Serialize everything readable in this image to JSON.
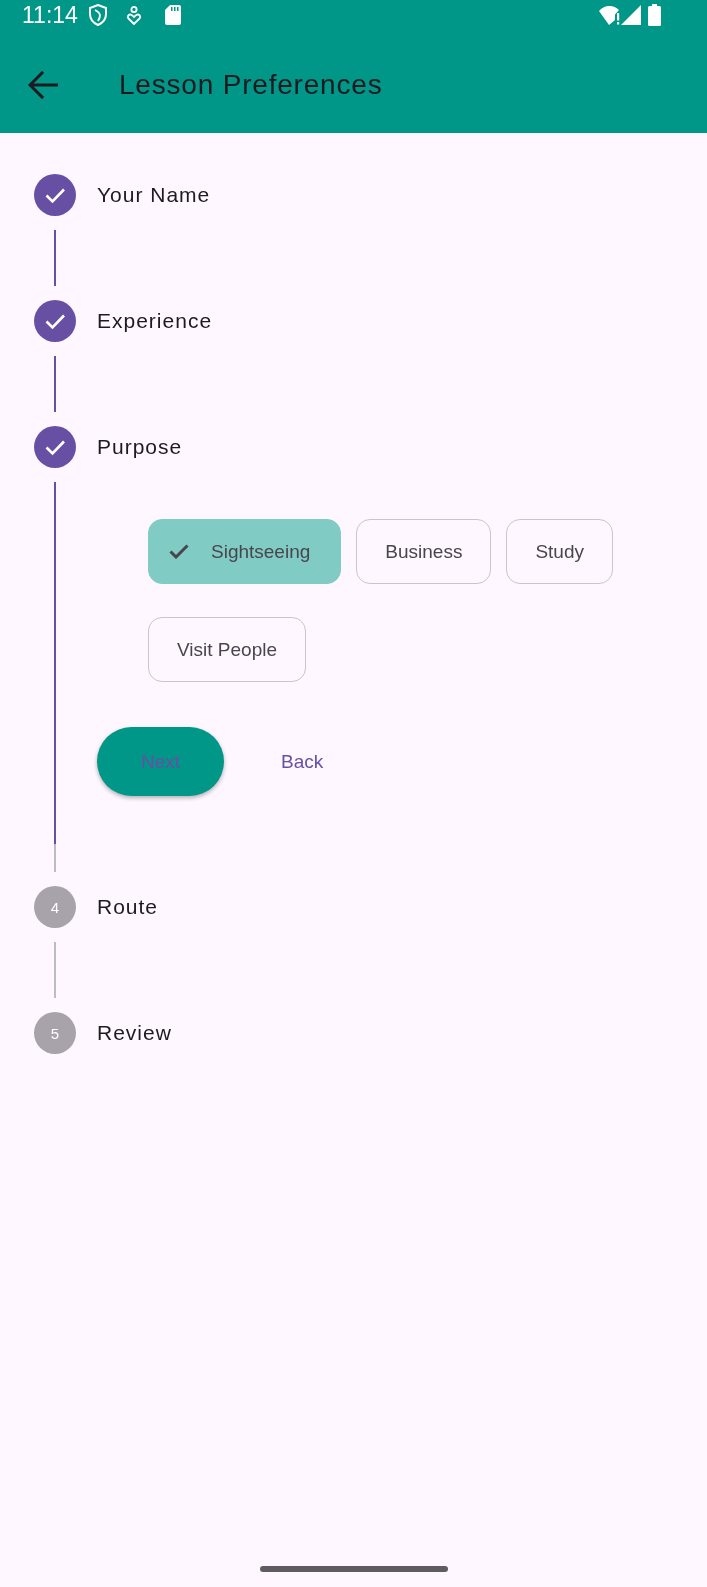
{
  "status_bar": {
    "time": "11:14"
  },
  "app_bar": {
    "title": "Lesson Preferences"
  },
  "steps": [
    {
      "label": "Your Name",
      "completed": true
    },
    {
      "label": "Experience",
      "completed": true
    },
    {
      "label": "Purpose",
      "completed": true,
      "options": [
        {
          "label": "Sightseeing",
          "selected": true
        },
        {
          "label": "Business",
          "selected": false
        },
        {
          "label": "Study",
          "selected": false
        },
        {
          "label": "Visit People",
          "selected": false
        }
      ],
      "actions": [
        {
          "label": "Next",
          "kind": "filled"
        },
        {
          "label": "Back",
          "kind": "text"
        }
      ]
    },
    {
      "label": "Route",
      "completed": false,
      "number": "4"
    },
    {
      "label": "Review",
      "completed": false,
      "number": "5"
    }
  ]
}
